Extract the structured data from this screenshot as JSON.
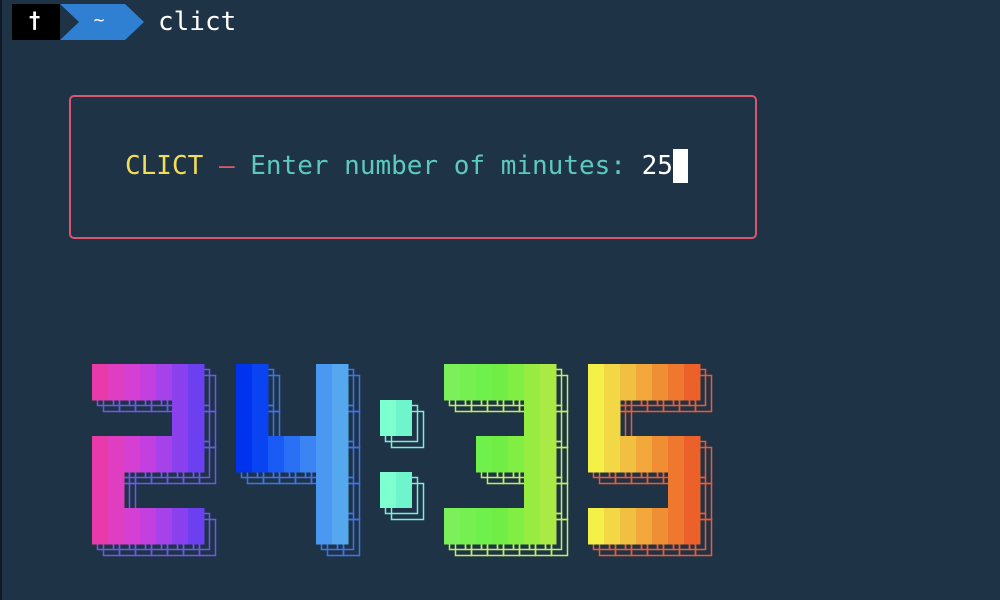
{
  "prompt": {
    "root_symbol": "†",
    "directory": "~",
    "command": "clict"
  },
  "input_prompt": {
    "app_name": "CLICT",
    "separator": "–",
    "question": "Enter number of minutes:",
    "value": "25"
  },
  "timer": {
    "text": "24:35",
    "digit_palettes": [
      [
        "#e83aa8",
        "#e03ec0",
        "#d640d2",
        "#c43fe0",
        "#a542ea",
        "#8a40ee",
        "#6c3ff0"
      ],
      [
        "#0033ee",
        "#0a44f2",
        "#1a5af5",
        "#2a70f5",
        "#3a84f4",
        "#4a98f2",
        "#55a8ee"
      ],
      [
        "#7dffd0",
        "#6ef5cc"
      ],
      [
        "#7cf05a",
        "#76f050",
        "#70f04a",
        "#70ee46",
        "#80ee42",
        "#96ec40",
        "#aaea44"
      ],
      [
        "#f4f048",
        "#f2d844",
        "#f2c040",
        "#f2a83a",
        "#f08e34",
        "#ee782e",
        "#ec602a"
      ]
    ],
    "outline_colors": [
      "#6a5ae8",
      "#3a74f0",
      "#78f0d4",
      "#c0f060",
      "#f05a30"
    ]
  }
}
